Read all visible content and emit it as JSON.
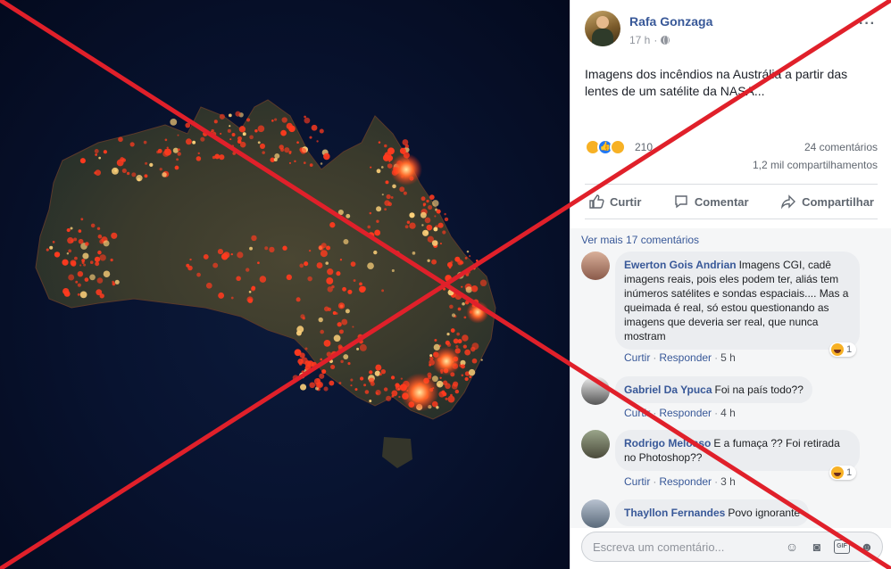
{
  "post": {
    "author": "Rafa Gonzaga",
    "time": "17 h",
    "privacy_icon": "globe-icon",
    "text": "Imagens dos incêndios na Austrália a partir das lentes de um satélite da NASA...",
    "reaction_count": "210",
    "comments_count": "24 comentários",
    "shares_count": "1,2 mil compartilhamentos"
  },
  "actions": {
    "like": "Curtir",
    "comment": "Comentar",
    "share": "Compartilhar"
  },
  "comments_section": {
    "see_more": "Ver mais 17 comentários",
    "items": [
      {
        "name": "Ewerton Gois Andrian",
        "text": "Imagens CGI, cadê imagens reais, pois eles podem ter, aliás tem inúmeros satélites e sondas espaciais.... Mas a queimada é real, só estou questionando as imagens que deveria ser real, que nunca mostram",
        "like": "Curtir",
        "reply": "Responder",
        "time": "5 h",
        "reactions": "1"
      },
      {
        "name": "Gabriel Da Ypuca",
        "text": "Foi na país todo??",
        "like": "Curtir",
        "reply": "Responder",
        "time": "4 h"
      },
      {
        "name": "Rodrigo Melosso",
        "text": "E a fumaça ?? Foi retirada no Photoshop??",
        "like": "Curtir",
        "reply": "Responder",
        "time": "3 h",
        "reactions": "1"
      },
      {
        "name": "Thayllon Fernandes",
        "text": "Povo ignorante"
      }
    ],
    "input_placeholder": "Escreva um comentário..."
  },
  "overlay": {
    "color": "#e0202a"
  }
}
